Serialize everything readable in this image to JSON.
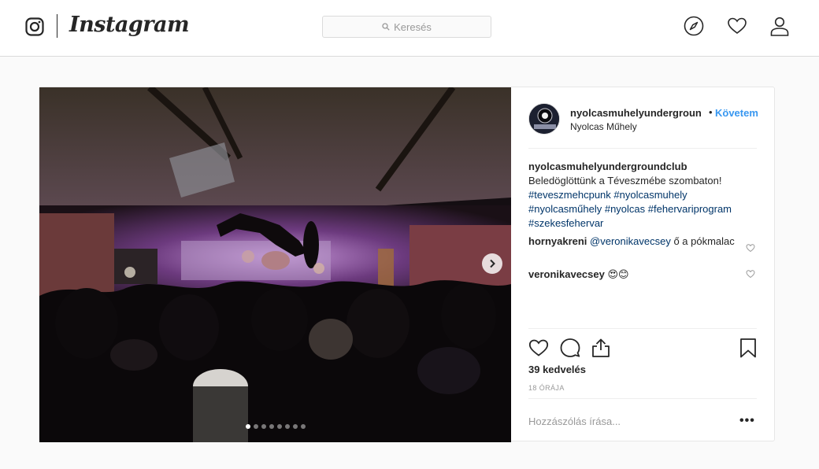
{
  "nav": {
    "brand": "Instagram",
    "search_placeholder": "Keresés"
  },
  "post": {
    "username": "nyolcasmuhelyundergroun",
    "follow_separator": "•",
    "follow_label": "Követem",
    "location": "Nyolcas Műhely",
    "caption": {
      "username": "nyolcasmuhelyundergroundclub",
      "text": "Beledöglöttünk a Téveszmébe szombaton!",
      "hashtags": [
        "#teveszmehcpunk",
        "#nyolcasmuhely",
        "#nyolcasműhely",
        "#nyolcas",
        "#fehervariprogram",
        "#szekesfehervar"
      ]
    },
    "comments": [
      {
        "username": "hornyakreni",
        "mention": "@veronikavecsey",
        "text": " ő a pókmalac"
      },
      {
        "username": "veronikavecsey",
        "mention": "",
        "text": " 😍😊"
      }
    ],
    "likes": "39 kedvelés",
    "timestamp": "18 ÓRÁJA",
    "comment_placeholder": "Hozzászólás írása...",
    "more_label": "•••",
    "carousel": {
      "total": 8,
      "active_index": 0
    }
  }
}
